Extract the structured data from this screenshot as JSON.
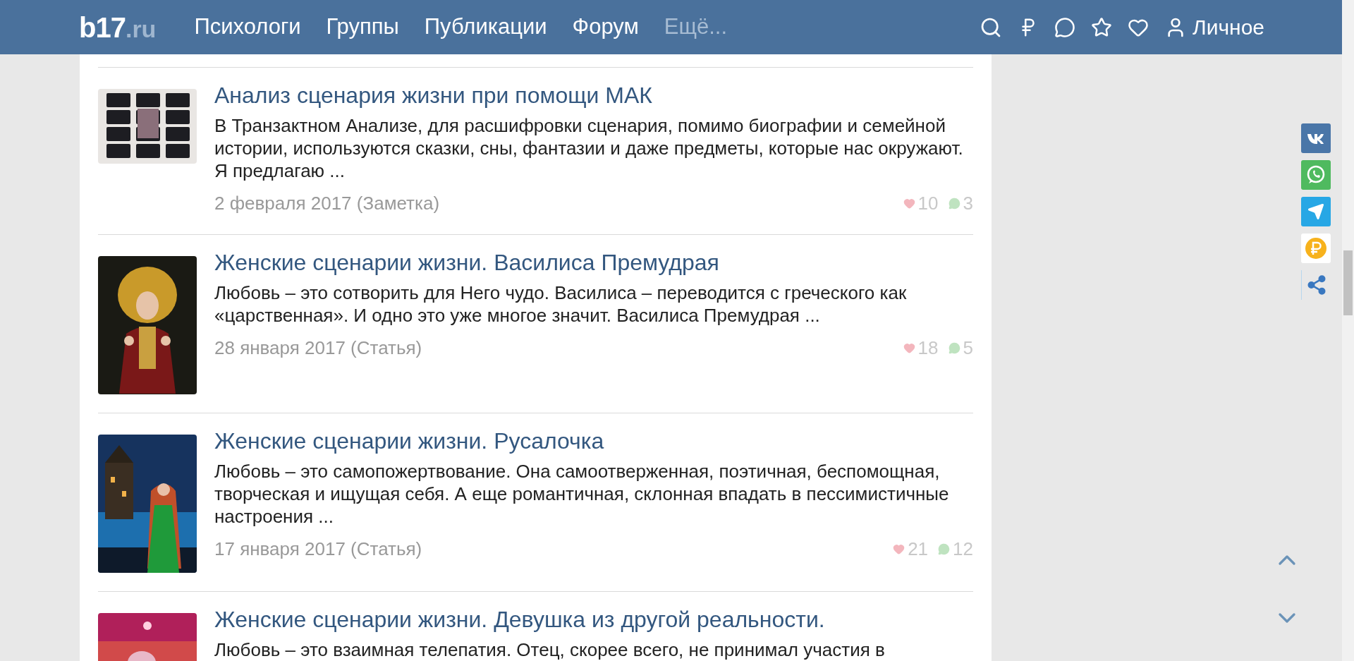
{
  "header": {
    "logo": {
      "main": "b17",
      "suffix": ".ru"
    },
    "nav": [
      {
        "label": "Психологи",
        "muted": false
      },
      {
        "label": "Группы",
        "muted": false
      },
      {
        "label": "Публикации",
        "muted": false
      },
      {
        "label": "Форум",
        "muted": false
      },
      {
        "label": "Ещё...",
        "muted": true
      }
    ],
    "account": "Личное"
  },
  "posts": [
    {
      "title": "Анализ сценария жизни при помощи МАК",
      "excerpt": "В Транзактном Анализе, для расшифровки сценария, помимо биографии и семейной истории, используются сказки, сны, фантазии и даже предметы, которые нас окружают. Я предлагаю ...",
      "meta": "2 февраля 2017 (Заметка)",
      "likes": "10",
      "comments": "3"
    },
    {
      "title": "Женские сценарии жизни. Василиса Премудрая",
      "excerpt": "Любовь – это сотворить для Него чудо. Василиса – переводится с греческого как «царственная». И одно это уже многое значит. Василиса Премудрая ...",
      "meta": "28 января 2017 (Статья)",
      "likes": "18",
      "comments": "5"
    },
    {
      "title": "Женские сценарии жизни. Русалочка",
      "excerpt": "Любовь – это самопожертвование. Она самоотверженная, поэтичная, беспомощная, творческая и ищущая себя. А еще романтичная, склонная впадать в пессимистичные настроения ...",
      "meta": "17 января 2017 (Статья)",
      "likes": "21",
      "comments": "12"
    },
    {
      "title": "Женские сценарии жизни. Девушка из другой реальности.",
      "excerpt": "Любовь – это взаимная телепатия. Отец, скорее всего, не принимал участия в"
    }
  ]
}
